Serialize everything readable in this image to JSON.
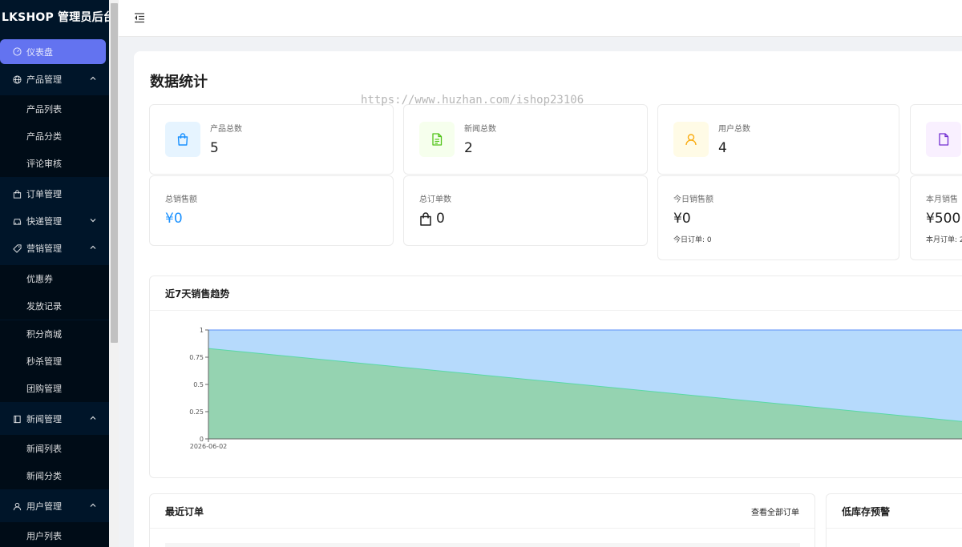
{
  "app": {
    "title": "LKSHOP 管理员后台"
  },
  "sidebar": {
    "items": [
      {
        "label": "仪表盘",
        "icon": "dashboard-icon",
        "level": "top",
        "active": true
      },
      {
        "label": "产品管理",
        "icon": "globe-icon",
        "level": "top",
        "expanded": true
      },
      {
        "label": "产品列表",
        "level": "sub"
      },
      {
        "label": "产品分类",
        "level": "sub"
      },
      {
        "label": "评论审核",
        "level": "sub"
      },
      {
        "label": "订单管理",
        "icon": "bag-icon",
        "level": "top"
      },
      {
        "label": "快递管理",
        "icon": "car-icon",
        "level": "top",
        "expanded": false
      },
      {
        "label": "营销管理",
        "icon": "tag-icon",
        "level": "top",
        "expanded": true
      },
      {
        "label": "优惠券",
        "level": "sub"
      },
      {
        "label": "发放记录",
        "level": "sub"
      },
      {
        "label": "积分商城",
        "level": "sub"
      },
      {
        "label": "秒杀管理",
        "level": "sub"
      },
      {
        "label": "团购管理",
        "level": "sub"
      },
      {
        "label": "新闻管理",
        "icon": "book-icon",
        "level": "top",
        "expanded": true
      },
      {
        "label": "新闻列表",
        "level": "sub"
      },
      {
        "label": "新闻分类",
        "level": "sub"
      },
      {
        "label": "用户管理",
        "icon": "user-icon",
        "level": "top",
        "expanded": true
      },
      {
        "label": "用户列表",
        "level": "sub"
      }
    ]
  },
  "main": {
    "title": "数据统计",
    "watermark": "https://www.huzhan.com/ishop23106",
    "stats": [
      {
        "label": "产品总数",
        "value": "5",
        "icon": "shopping-bag-icon",
        "color": "#1890ff",
        "bg": "#e6f4ff"
      },
      {
        "label": "新闻总数",
        "value": "2",
        "icon": "file-text-icon",
        "color": "#52c41a",
        "bg": "#f6ffed"
      },
      {
        "label": "用户总数",
        "value": "4",
        "icon": "user-icon",
        "color": "#faad14",
        "bg": "#fffbe6"
      },
      {
        "label": "",
        "value": "",
        "icon": "file-icon",
        "color": "#722ed1",
        "bg": "#f9f0ff"
      }
    ],
    "sales": [
      {
        "label": "总销售额",
        "value": "¥0",
        "value_color": "#1890ff"
      },
      {
        "label": "总订单数",
        "value": "0",
        "icon": "shopping-bag-icon"
      },
      {
        "label": "今日销售额",
        "value": "¥0",
        "sub": "今日订单: 0"
      },
      {
        "label": "本月销售",
        "value": "¥500",
        "sub": "本月订单: 2"
      }
    ],
    "trend": {
      "title": "近7天销售趋势"
    },
    "orders": {
      "title": "最近订单",
      "view_all": "查看全部订单"
    },
    "stock": {
      "title": "低库存预警"
    }
  },
  "chart_data": {
    "type": "area",
    "x": [
      "2026-06-02"
    ],
    "y_ticks": [
      "0",
      "0.25",
      "0.5",
      "0.75",
      "1"
    ],
    "ylim": [
      0,
      1
    ],
    "series": [
      {
        "values_visible": [
          1,
          1
        ],
        "color": "#b6dafc",
        "stroke": "#5b8ff9"
      },
      {
        "values_visible": [
          0.83,
          0.12
        ],
        "color": "#95d3b1",
        "stroke": "#5ad8a6"
      }
    ]
  }
}
